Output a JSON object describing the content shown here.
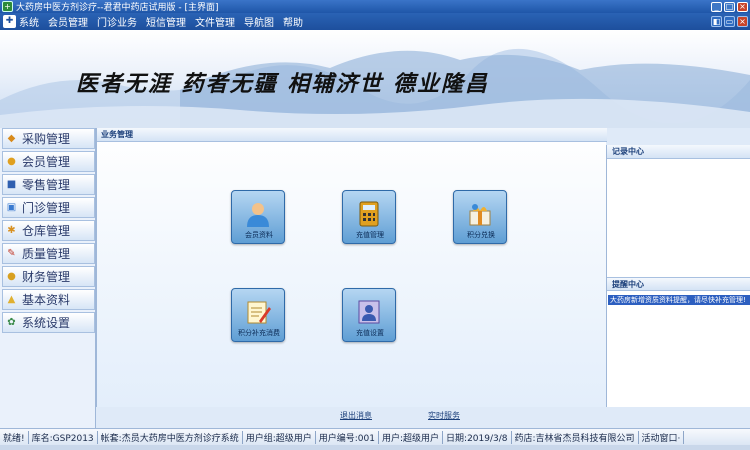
{
  "window": {
    "title": "大药房中医方剂诊疗--君君中药店试用版 - [主界面]",
    "controls": [
      "_",
      "□",
      "×"
    ]
  },
  "menubar": {
    "items": [
      "系统",
      "会员管理",
      "门诊业务",
      "短信管理",
      "文件管理",
      "导航图",
      "帮助"
    ]
  },
  "banner": {
    "slogan": "医者无涯  药者无疆  相辅济世  德业隆昌"
  },
  "sidebar": {
    "items": [
      {
        "label": "采购管理",
        "icon": "cart-icon",
        "color": "#d88a1a"
      },
      {
        "label": "会员管理",
        "icon": "member-icon",
        "color": "#e0a020"
      },
      {
        "label": "零售管理",
        "icon": "retail-icon",
        "color": "#2f5fb0"
      },
      {
        "label": "门诊管理",
        "icon": "clinic-icon",
        "color": "#3a7ad0"
      },
      {
        "label": "仓库管理",
        "icon": "warehouse-icon",
        "color": "#d89020"
      },
      {
        "label": "质量管理",
        "icon": "quality-icon",
        "color": "#c03a2a"
      },
      {
        "label": "财务管理",
        "icon": "finance-icon",
        "color": "#d8a020"
      },
      {
        "label": "基本资料",
        "icon": "folder-icon",
        "color": "#e0b030"
      },
      {
        "label": "系统设置",
        "icon": "settings-icon",
        "color": "#3a8a4a"
      }
    ]
  },
  "main": {
    "header": "业务管理",
    "tiles": [
      {
        "label": "会员资料",
        "icon": "person-icon"
      },
      {
        "label": "充值管理",
        "icon": "calculator-icon"
      },
      {
        "label": "积分兑换",
        "icon": "gift-icon"
      },
      {
        "label": "积分补充消费",
        "icon": "notepad-icon"
      },
      {
        "label": "充值设置",
        "icon": "member-card-icon"
      }
    ],
    "links": [
      "退出消息",
      "实时服务"
    ]
  },
  "rightpanel": {
    "record_header": "记录中心",
    "reminder_header": "提醒中心",
    "reminder_item": "大药房新增资质资料提醒，请尽快补充管理!"
  },
  "statusbar": {
    "segments": [
      "就绪!",
      "库名:GSP2013",
      "帐套:杰员大药房中医方剂诊疗系统",
      "用户组:超级用户",
      "用户编号:001",
      "用户:超级用户",
      "日期:2019/3/8",
      "药店:吉林省杰员科技有限公司",
      "活动窗口·"
    ]
  },
  "colors": {
    "titlebar": "#1f56a8",
    "menubar": "#2a63b5",
    "accent": "#2d5fc0"
  }
}
